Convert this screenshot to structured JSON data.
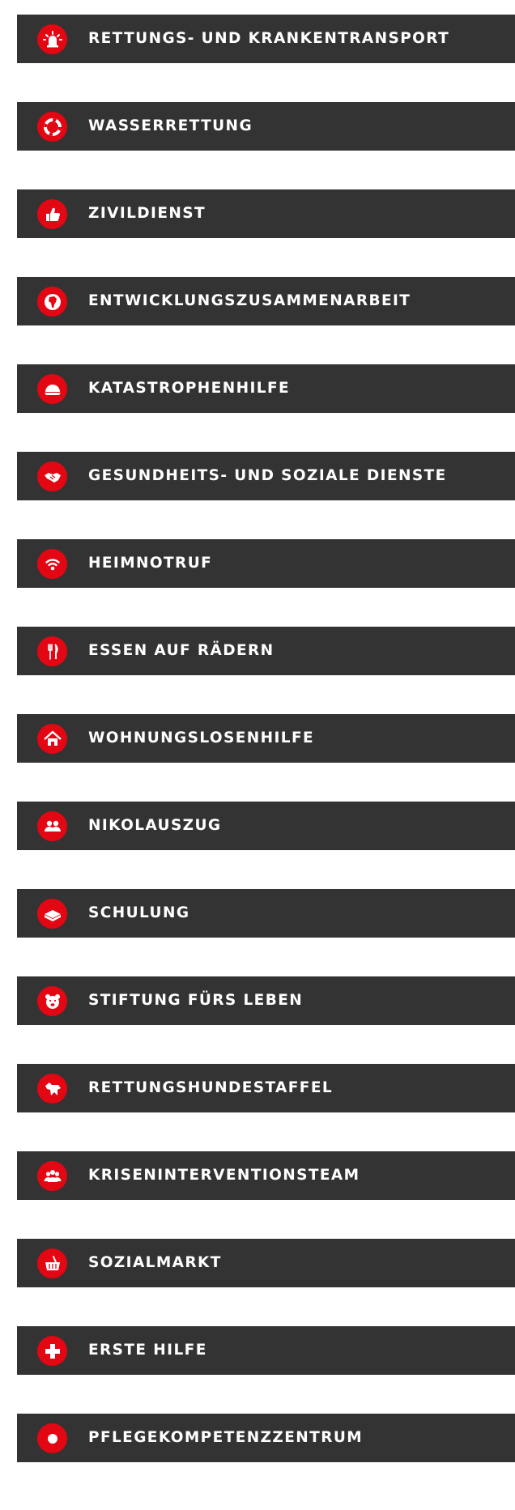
{
  "theme": {
    "bar_color": "#333333",
    "icon_color": "#e30613",
    "text_color": "#ffffff"
  },
  "services": [
    {
      "label": "RETTUNGS- UND KRANKENTRANSPORT",
      "icon": "siren-icon"
    },
    {
      "label": "WASSERRETTUNG",
      "icon": "lifebuoy-icon"
    },
    {
      "label": "ZIVILDIENST",
      "icon": "thumbs-up-icon"
    },
    {
      "label": "ENTWICKLUNGSZUSAMMENARBEIT",
      "icon": "globe-africa-icon"
    },
    {
      "label": "KATASTROPHENHILFE",
      "icon": "helmet-icon"
    },
    {
      "label": "GESUNDHEITS- UND SOZIALE DIENSTE",
      "icon": "handshake-icon"
    },
    {
      "label": "HEIMNOTRUF",
      "icon": "wifi-signal-icon"
    },
    {
      "label": "ESSEN AUF RÄDERN",
      "icon": "fork-knife-icon"
    },
    {
      "label": "WOHNUNGSLOSENHILFE",
      "icon": "house-icon"
    },
    {
      "label": "NIKOLAUSZUG",
      "icon": "people-group-icon"
    },
    {
      "label": "SCHULUNG",
      "icon": "book-icon"
    },
    {
      "label": "STIFTUNG FÜRS LEBEN",
      "icon": "teddy-bear-icon"
    },
    {
      "label": "RETTUNGSHUNDESTAFFEL",
      "icon": "rescue-dog-icon"
    },
    {
      "label": "KRISENINTERVENTIONSTEAM",
      "icon": "team-icon"
    },
    {
      "label": "SOZIALMARKT",
      "icon": "basket-icon"
    },
    {
      "label": "ERSTE HILFE",
      "icon": "cross-icon"
    },
    {
      "label": "PFLEGEKOMPETENZZENTRUM",
      "icon": "dot-icon"
    }
  ]
}
